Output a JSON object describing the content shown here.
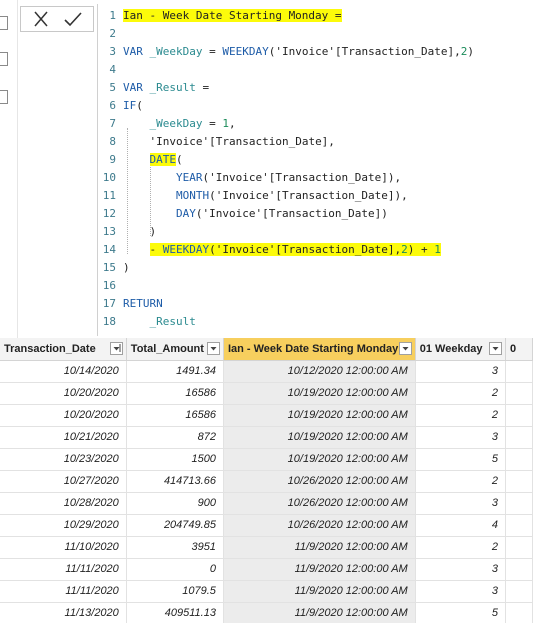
{
  "formula_bar": {
    "cancel_icon": "close-x-icon",
    "commit_icon": "checkmark-icon"
  },
  "code_lines": [
    {
      "n": "1",
      "tokens": [
        {
          "t": "Ian - Week Date Starting Monday =",
          "c": "c-dark",
          "hl": true
        }
      ]
    },
    {
      "n": "2",
      "tokens": []
    },
    {
      "n": "3",
      "tokens": [
        {
          "t": "VAR ",
          "c": "c-blue"
        },
        {
          "t": "_WeekDay",
          "c": "c-teal"
        },
        {
          "t": " = ",
          "c": "c-dark"
        },
        {
          "t": "WEEKDAY",
          "c": "c-blue"
        },
        {
          "t": "(",
          "c": "c-dark"
        },
        {
          "t": "'Invoice'",
          "c": "c-dark"
        },
        {
          "t": "[Transaction_Date]",
          "c": "c-dark"
        },
        {
          "t": ",",
          "c": "c-dark"
        },
        {
          "t": "2",
          "c": "c-num"
        },
        {
          "t": ")",
          "c": "c-dark"
        }
      ]
    },
    {
      "n": "4",
      "tokens": []
    },
    {
      "n": "5",
      "tokens": [
        {
          "t": "VAR ",
          "c": "c-blue"
        },
        {
          "t": "_Result",
          "c": "c-teal"
        },
        {
          "t": " =",
          "c": "c-dark"
        }
      ]
    },
    {
      "n": "6",
      "tokens": [
        {
          "t": "IF",
          "c": "c-blue"
        },
        {
          "t": "(",
          "c": "c-dark"
        }
      ]
    },
    {
      "n": "7",
      "tokens": [
        {
          "t": "    ",
          "c": "c-dark"
        },
        {
          "t": "_WeekDay",
          "c": "c-teal"
        },
        {
          "t": " = ",
          "c": "c-dark"
        },
        {
          "t": "1",
          "c": "c-num"
        },
        {
          "t": ",",
          "c": "c-dark"
        }
      ]
    },
    {
      "n": "8",
      "tokens": [
        {
          "t": "    ",
          "c": "c-dark"
        },
        {
          "t": "'Invoice'[Transaction_Date],",
          "c": "c-dark"
        }
      ]
    },
    {
      "n": "9",
      "tokens": [
        {
          "t": "    ",
          "c": "c-dark"
        },
        {
          "t": "DATE",
          "c": "c-blue",
          "hl": true
        },
        {
          "t": "(",
          "c": "c-dark"
        }
      ]
    },
    {
      "n": "10",
      "tokens": [
        {
          "t": "        ",
          "c": "c-dark"
        },
        {
          "t": "YEAR",
          "c": "c-blue"
        },
        {
          "t": "('Invoice'[Transaction_Date]),",
          "c": "c-dark"
        }
      ]
    },
    {
      "n": "11",
      "tokens": [
        {
          "t": "        ",
          "c": "c-dark"
        },
        {
          "t": "MONTH",
          "c": "c-blue"
        },
        {
          "t": "('Invoice'[Transaction_Date]),",
          "c": "c-dark"
        }
      ]
    },
    {
      "n": "12",
      "tokens": [
        {
          "t": "        ",
          "c": "c-dark"
        },
        {
          "t": "DAY",
          "c": "c-blue"
        },
        {
          "t": "('Invoice'[Transaction_Date])",
          "c": "c-dark"
        }
      ]
    },
    {
      "n": "13",
      "tokens": [
        {
          "t": "    )",
          "c": "c-dark"
        }
      ]
    },
    {
      "n": "14",
      "tokens": [
        {
          "t": "    ",
          "c": "c-dark"
        },
        {
          "t": "- ",
          "c": "c-dark",
          "hl": true
        },
        {
          "t": "WEEKDAY",
          "c": "c-blue",
          "hl": true
        },
        {
          "t": "('Invoice'[Transaction_Date],",
          "c": "c-dark",
          "hl": true
        },
        {
          "t": "2",
          "c": "c-num",
          "hl": true
        },
        {
          "t": ") + ",
          "c": "c-dark",
          "hl": true
        },
        {
          "t": "1",
          "c": "c-num",
          "hl": true
        }
      ]
    },
    {
      "n": "15",
      "tokens": [
        {
          "t": ")",
          "c": "c-dark"
        }
      ]
    },
    {
      "n": "16",
      "tokens": []
    },
    {
      "n": "17",
      "tokens": [
        {
          "t": "RETURN",
          "c": "c-blue"
        }
      ]
    },
    {
      "n": "18",
      "tokens": [
        {
          "t": "    ",
          "c": "c-dark"
        },
        {
          "t": "_Result",
          "c": "c-teal"
        }
      ]
    }
  ],
  "table": {
    "columns": [
      {
        "label": "Transaction_Date",
        "filter_icon": "sort-filter-icon"
      },
      {
        "label": "Total_Amount",
        "filter_icon": "dropdown-icon"
      },
      {
        "label": "Ian - Week Date Starting Monday",
        "filter_icon": "dropdown-icon",
        "selected": true
      },
      {
        "label": "01 Weekday",
        "filter_icon": "dropdown-icon"
      },
      {
        "label": "0",
        "filter_icon": ""
      }
    ],
    "rows": [
      [
        "10/14/2020",
        "1491.34",
        "10/12/2020 12:00:00 AM",
        "3",
        ""
      ],
      [
        "10/20/2020",
        "16586",
        "10/19/2020 12:00:00 AM",
        "2",
        ""
      ],
      [
        "10/20/2020",
        "16586",
        "10/19/2020 12:00:00 AM",
        "2",
        ""
      ],
      [
        "10/21/2020",
        "872",
        "10/19/2020 12:00:00 AM",
        "3",
        ""
      ],
      [
        "10/23/2020",
        "1500",
        "10/19/2020 12:00:00 AM",
        "5",
        ""
      ],
      [
        "10/27/2020",
        "414713.66",
        "10/26/2020 12:00:00 AM",
        "2",
        ""
      ],
      [
        "10/28/2020",
        "900",
        "10/26/2020 12:00:00 AM",
        "3",
        ""
      ],
      [
        "10/29/2020",
        "204749.85",
        "10/26/2020 12:00:00 AM",
        "4",
        ""
      ],
      [
        "11/10/2020",
        "3951",
        "11/9/2020 12:00:00 AM",
        "2",
        ""
      ],
      [
        "11/11/2020",
        "0",
        "11/9/2020 12:00:00 AM",
        "3",
        ""
      ],
      [
        "11/11/2020",
        "1079.5",
        "11/9/2020 12:00:00 AM",
        "3",
        ""
      ],
      [
        "11/13/2020",
        "409511.13",
        "11/9/2020 12:00:00 AM",
        "5",
        ""
      ]
    ]
  },
  "colors": {
    "highlight": "#fcfb0a",
    "selected_header": "#f7cf5e",
    "selected_column": "#ececec",
    "keyword": "#1e5ca8",
    "variable": "#2a8a8f",
    "number": "#1b8c5a"
  }
}
